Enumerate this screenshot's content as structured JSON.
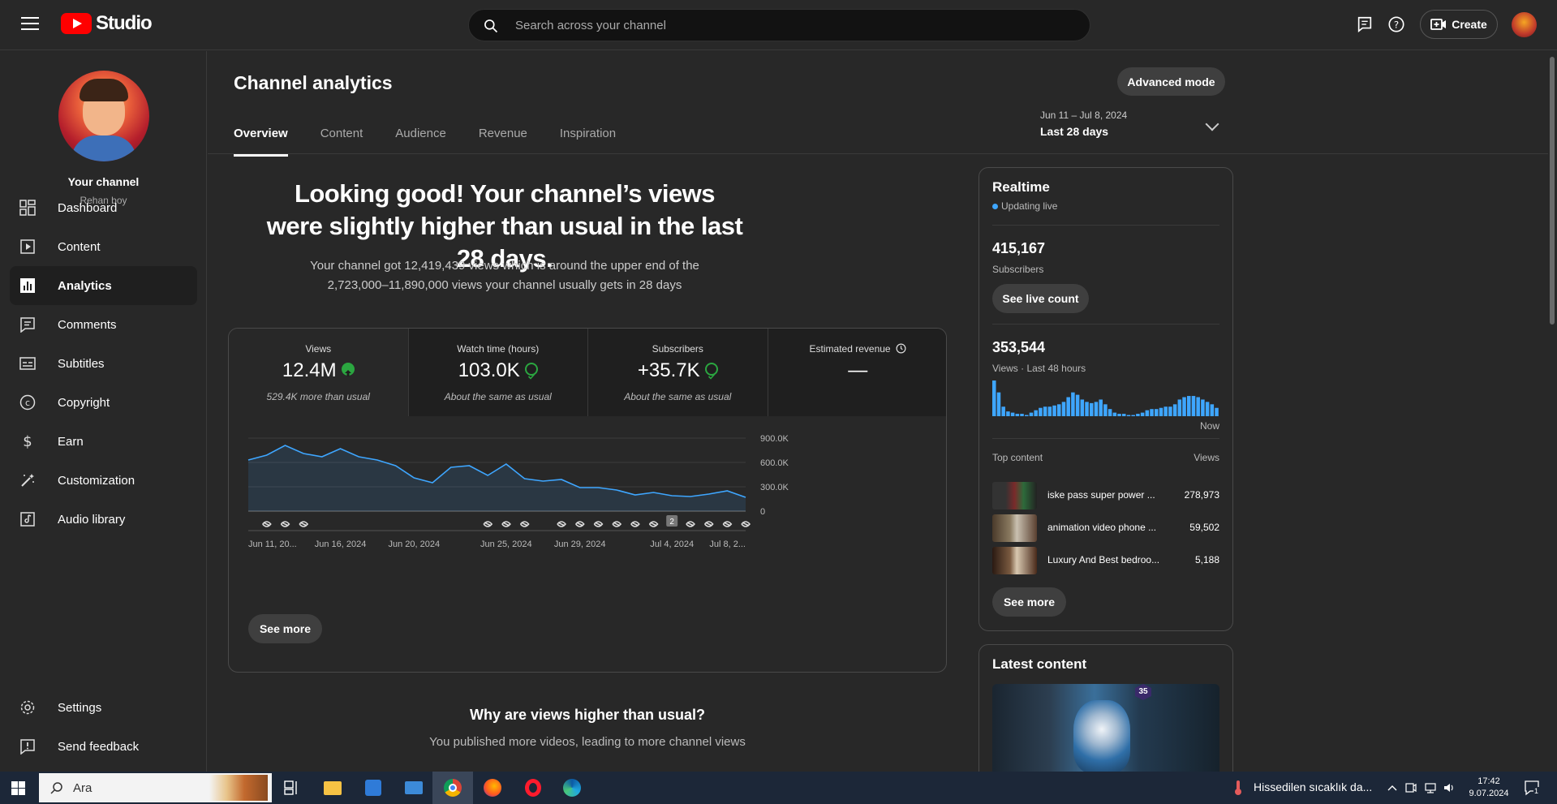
{
  "header": {
    "logo_text": "Studio",
    "search_placeholder": "Search across your channel",
    "create_label": "Create"
  },
  "channel": {
    "title": "Your channel",
    "name": "Rehan boy"
  },
  "sidebar": {
    "items": [
      {
        "label": "Dashboard",
        "icon": "dashboard-icon"
      },
      {
        "label": "Content",
        "icon": "content-icon"
      },
      {
        "label": "Analytics",
        "icon": "analytics-icon"
      },
      {
        "label": "Comments",
        "icon": "comments-icon"
      },
      {
        "label": "Subtitles",
        "icon": "subtitles-icon"
      },
      {
        "label": "Copyright",
        "icon": "copyright-icon"
      },
      {
        "label": "Earn",
        "icon": "earn-icon"
      },
      {
        "label": "Customization",
        "icon": "customization-icon"
      },
      {
        "label": "Audio library",
        "icon": "audio-library-icon"
      }
    ],
    "settings_label": "Settings",
    "feedback_label": "Send feedback"
  },
  "page": {
    "title": "Channel analytics",
    "advanced_mode_label": "Advanced mode",
    "tabs": [
      "Overview",
      "Content",
      "Audience",
      "Revenue",
      "Inspiration"
    ],
    "date_range": "Jun 11 – Jul 8, 2024",
    "date_period": "Last 28 days",
    "headline": "Looking good! Your channel’s views were slightly higher than usual in the last 28 days.",
    "subline": "Your channel got 12,419,439 views which is around the upper end of the 2,723,000–11,890,000 views your channel usually gets in 28 days",
    "see_more_label": "See more",
    "why_title": "Why are views higher than usual?",
    "why_sub": "You published more videos, leading to more channel views"
  },
  "stats": [
    {
      "label": "Views",
      "value": "12.4M",
      "note": "529.4K more than usual",
      "status": "up"
    },
    {
      "label": "Watch time (hours)",
      "value": "103.0K",
      "note": "About the same as usual",
      "status": "ok"
    },
    {
      "label": "Subscribers",
      "value": "+35.7K",
      "note": "About the same as usual",
      "status": "ok"
    },
    {
      "label": "Estimated revenue",
      "value": "—",
      "note": "",
      "status": "clock"
    }
  ],
  "chart_data": {
    "type": "area",
    "title": "",
    "xlabel": "",
    "ylabel": "",
    "x_tick_labels": [
      "Jun 11, 20...",
      "Jun 16, 2024",
      "Jun 20, 2024",
      "Jun 25, 2024",
      "Jun 29, 2024",
      "Jul 4, 2024",
      "Jul 8, 2..."
    ],
    "y_tick_labels": [
      "900.0K",
      "600.0K",
      "300.0K",
      "0"
    ],
    "ylim": [
      0,
      900000
    ],
    "x": [
      "Jun 11",
      "Jun 12",
      "Jun 13",
      "Jun 14",
      "Jun 15",
      "Jun 16",
      "Jun 17",
      "Jun 18",
      "Jun 19",
      "Jun 20",
      "Jun 21",
      "Jun 22",
      "Jun 23",
      "Jun 24",
      "Jun 25",
      "Jun 26",
      "Jun 27",
      "Jun 28",
      "Jun 29",
      "Jun 30",
      "Jul 1",
      "Jul 2",
      "Jul 3",
      "Jul 4",
      "Jul 5",
      "Jul 6",
      "Jul 7",
      "Jul 8"
    ],
    "series": [
      {
        "values": [
          630000,
          690000,
          810000,
          710000,
          670000,
          770000,
          670000,
          630000,
          560000,
          410000,
          350000,
          540000,
          560000,
          440000,
          580000,
          400000,
          370000,
          390000,
          290000,
          290000,
          260000,
          200000,
          230000,
          190000,
          180000,
          210000,
          250000,
          170000
        ]
      }
    ],
    "marker_days": [
      1,
      2,
      3,
      13,
      14,
      15,
      17,
      18,
      19,
      20,
      21,
      22,
      24,
      25,
      26,
      27
    ],
    "grouped_marker": {
      "day": 23,
      "label": "2"
    },
    "grid": true,
    "color": "#3ea6ff"
  },
  "realtime": {
    "title": "Realtime",
    "live_label": "Updating live",
    "subscribers_value": "415,167",
    "subscribers_label": "Subscribers",
    "live_count_label": "See live count",
    "views_value": "353,544",
    "views_label": "Views · Last 48 hours",
    "now_label": "Now",
    "bars": [
      30,
      20,
      8,
      4,
      3,
      2,
      2,
      1,
      3,
      5,
      7,
      8,
      8,
      9,
      10,
      12,
      16,
      20,
      18,
      14,
      12,
      11,
      12,
      14,
      10,
      6,
      3,
      2,
      2,
      1,
      1,
      2,
      3,
      5,
      6,
      6,
      7,
      8,
      8,
      10,
      14,
      16,
      17,
      17,
      16,
      14,
      12,
      10,
      7
    ],
    "top_content_label": "Top content",
    "views_col_label": "Views",
    "top_content": [
      {
        "title": "iske pass super power ...",
        "views": "278,973"
      },
      {
        "title": "animation video phone ...",
        "views": "59,502"
      },
      {
        "title": "Luxury And Best bedroo...",
        "views": "5,188"
      }
    ],
    "see_more_label": "See more"
  },
  "latest": {
    "title": "Latest content",
    "badge": "35"
  },
  "taskbar": {
    "search_label": "Ara",
    "weather_text": "Hissedilen sıcaklık da...",
    "time": "17:42",
    "date": "9.07.2024",
    "notification_count": "1"
  }
}
